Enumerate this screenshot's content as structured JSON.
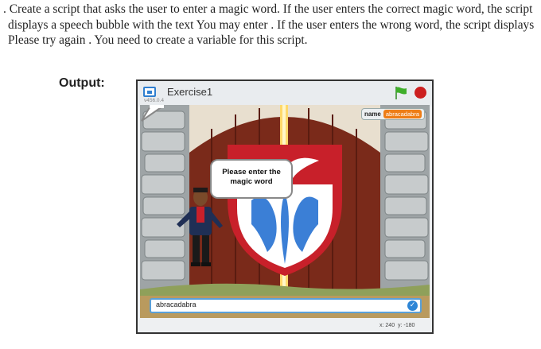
{
  "instructions": {
    "line1": ". Create a script that asks the user to enter a magic word. If the user enters the correct magic word, the script",
    "line2": "displays a speech bubble with the text  You may enter . If the user enters the wrong word, the script displays",
    "line3": "Please try again . You need to create a variable for this script."
  },
  "output_label": "Output:",
  "player": {
    "title": "Exercise1",
    "version": "v456.0.4",
    "variable": {
      "name": "name",
      "value": "abracadabra"
    },
    "speech_bubble": "Please enter the magic word",
    "answer": "abracadabra",
    "coords": {
      "x_label": "x:",
      "x_value": "240",
      "y_label": "y:",
      "y_value": "-180"
    }
  },
  "colors": {
    "accent_blue": "#2f86d6",
    "stop_red": "#cc1f1f",
    "flag_green": "#3fae2a",
    "variable_orange": "#ee7d16"
  },
  "icons": [
    "app-icon",
    "green-flag-icon",
    "stop-icon",
    "checkmark-icon"
  ]
}
